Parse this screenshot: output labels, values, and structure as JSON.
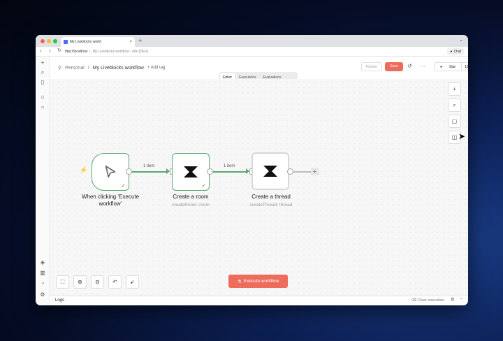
{
  "browser": {
    "tab_title": "My Liveblocks workf",
    "url_host": "http://localhost",
    "url_rest": "My Liveblocks workflow - n8n [DEV]",
    "chat_label": "Chat"
  },
  "header": {
    "breadcrumb_root": "Personal",
    "breadcrumb_sep": "/",
    "workflow_name": "My Liveblocks workflow",
    "add_tag": "+ Add tag",
    "publish_label": "Publish",
    "save_label": "Save",
    "star_label": "Star",
    "star_count": "181,846"
  },
  "view_tabs": [
    "Editor",
    "Executions",
    "Evaluations"
  ],
  "nodes": [
    {
      "title_l1": "When clicking ‘Execute",
      "title_l2": "workflow’",
      "subtitle": ""
    },
    {
      "title_l1": "Create a room",
      "title_l2": "",
      "subtitle": "createRoom: room"
    },
    {
      "title_l1": "Create a thread",
      "title_l2": "",
      "subtitle": "createThread: thread"
    }
  ],
  "edges": [
    {
      "label": "1 item"
    },
    {
      "label": "1 item"
    }
  ],
  "execute_label": "Execute workflow",
  "logs": {
    "title": "Logs",
    "clear_label": "Clear execution"
  },
  "colors": {
    "accent": "#ee6c5b",
    "success": "#5aa872"
  }
}
